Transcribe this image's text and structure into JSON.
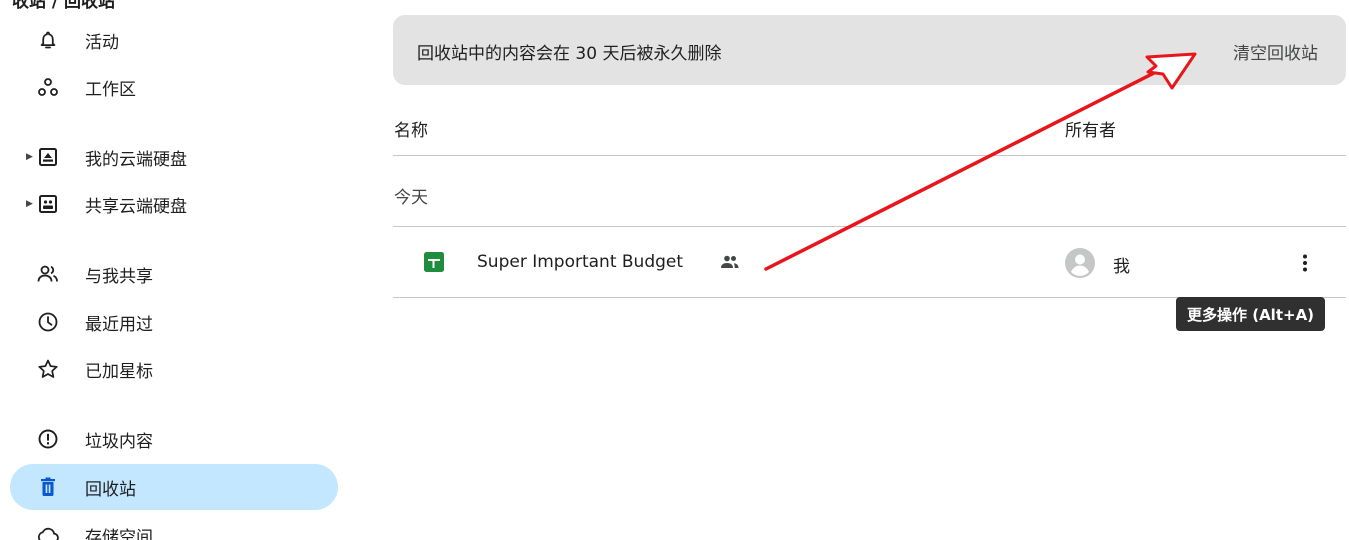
{
  "sidebar": {
    "top_cut_label": "收站 / 回收站",
    "items": [
      {
        "label": "活动",
        "icon": "bell-icon"
      },
      {
        "label": "工作区",
        "icon": "workspaces-icon"
      },
      {
        "label": "我的云端硬盘",
        "icon": "my-drive-icon"
      },
      {
        "label": "共享云端硬盘",
        "icon": "shared-drives-icon"
      },
      {
        "label": "与我共享",
        "icon": "people-icon"
      },
      {
        "label": "最近用过",
        "icon": "clock-icon"
      },
      {
        "label": "已加星标",
        "icon": "star-icon"
      },
      {
        "label": "垃圾内容",
        "icon": "spam-icon"
      },
      {
        "label": "回收站",
        "icon": "trash-icon"
      },
      {
        "label": "存储空间",
        "icon": "cloud-icon"
      }
    ]
  },
  "banner": {
    "message": "回收站中的内容会在 30 天后被永久删除",
    "empty_trash_label": "清空回收站"
  },
  "table": {
    "headers": {
      "name": "名称",
      "owner": "所有者"
    },
    "group_label": "今天",
    "rows": [
      {
        "name": "Super Important Budget",
        "owner": "我",
        "file_icon": "google-sheets-icon",
        "shared_icon": "shared-people-icon"
      }
    ]
  },
  "tooltip": {
    "text": "更多操作 (Alt+A)"
  },
  "colors": {
    "active_nav": "#c2e7ff",
    "banner_bg": "#e3e3e3",
    "sheets_green": "#1e8e3e",
    "annotation_red": "#e8151b"
  }
}
